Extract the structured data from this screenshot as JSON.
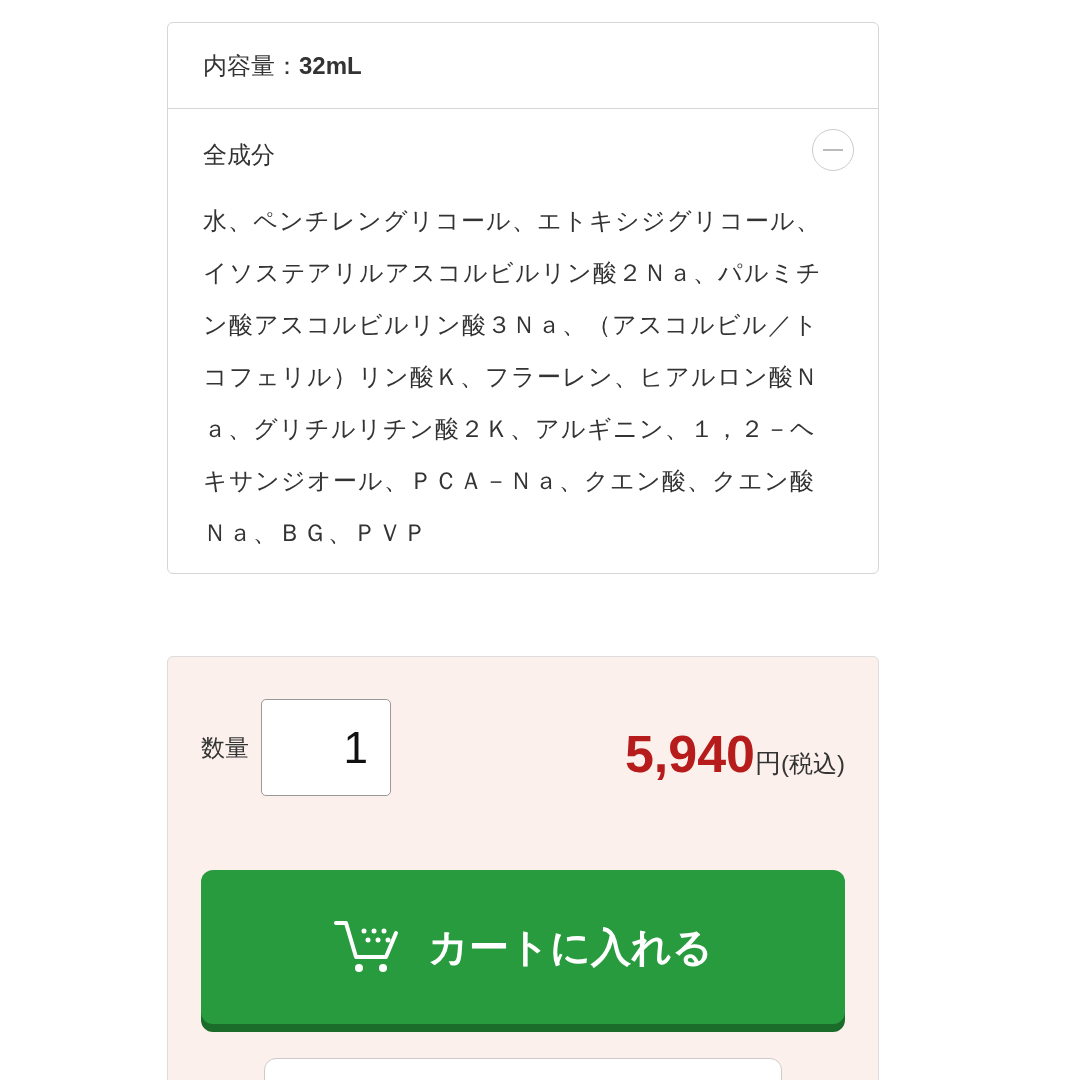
{
  "capacity": {
    "label": "内容量：",
    "value": "32mL"
  },
  "ingredients": {
    "title": "全成分",
    "expanded": true,
    "text": "水、ペンチレングリコール、エトキシジグリコール、イソステアリルアスコルビルリン酸２Ｎａ、パルミチン酸アスコルビルリン酸３Ｎａ、（アスコルビル／トコフェリル）リン酸Ｋ、フラーレン、ヒアルロン酸Ｎａ、グリチルリチン酸２Ｋ、アルギニン、１，２－ヘキサンジオール、ＰＣＡ－Ｎａ、クエン酸、クエン酸Ｎａ、ＢＧ、ＰＶＰ"
  },
  "purchase": {
    "quantity_label": "数量",
    "quantity": "1",
    "price": "5,940",
    "currency": "円",
    "tax_note": "(税込)",
    "cart_button": "カートに入れる"
  }
}
